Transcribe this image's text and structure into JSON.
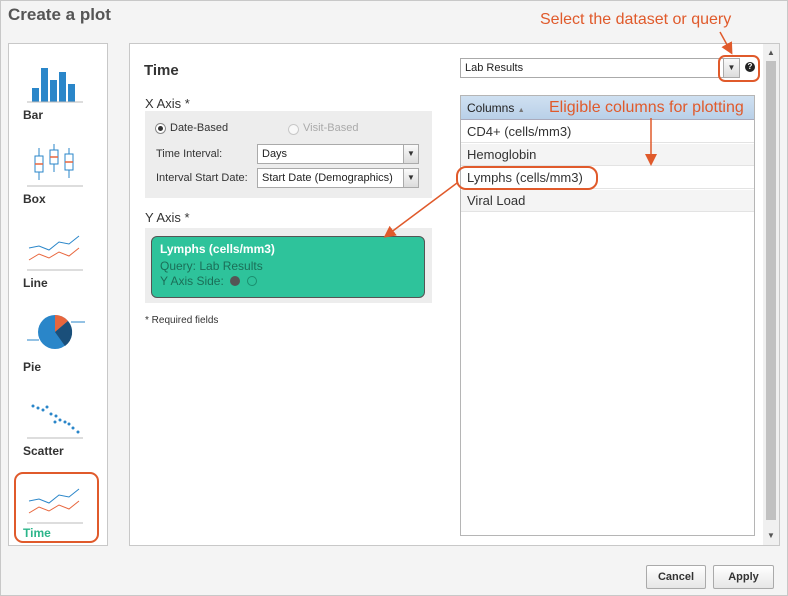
{
  "dialog": {
    "title": "Create a plot"
  },
  "chart_types": [
    {
      "label": "Bar",
      "icon": "bar-chart-icon"
    },
    {
      "label": "Box",
      "icon": "box-plot-icon"
    },
    {
      "label": "Line",
      "icon": "line-chart-icon"
    },
    {
      "label": "Pie",
      "icon": "pie-chart-icon"
    },
    {
      "label": "Scatter",
      "icon": "scatter-plot-icon"
    },
    {
      "label": "Time",
      "icon": "time-chart-icon",
      "selected": true
    }
  ],
  "main": {
    "title": "Time",
    "x_axis": {
      "label": "X Axis *",
      "options": {
        "date_based": "Date-Based",
        "visit_based": "Visit-Based"
      },
      "selected_option": "date_based",
      "time_interval_label": "Time Interval:",
      "time_interval_value": "Days",
      "start_date_label": "Interval Start Date:",
      "start_date_value": "Start Date (Demographics)"
    },
    "y_axis": {
      "label": "Y Axis *",
      "measure_name": "Lymphs (cells/mm3)",
      "measure_query": "Query: Lab Results",
      "measure_side": "Y Axis Side:"
    },
    "required_note": "* Required fields",
    "query_select_value": "Lab Results",
    "help_icon_glyph": "?",
    "columns": {
      "header": "Columns",
      "items": [
        "CD4+ (cells/mm3)",
        "Hemoglobin",
        "Lymphs (cells/mm3)",
        "Viral Load"
      ]
    }
  },
  "annotations": {
    "select_dataset": "Select the dataset or query",
    "eligible_columns": "Eligible columns for plotting"
  },
  "buttons": {
    "cancel": "Cancel",
    "apply": "Apply"
  },
  "colors": {
    "accent": "#e05a2b",
    "measure_card": "#2ec39b",
    "selected_type": "#2bb58a",
    "chart_blue": "#2a86c9",
    "chart_orange": "#e8663d"
  }
}
